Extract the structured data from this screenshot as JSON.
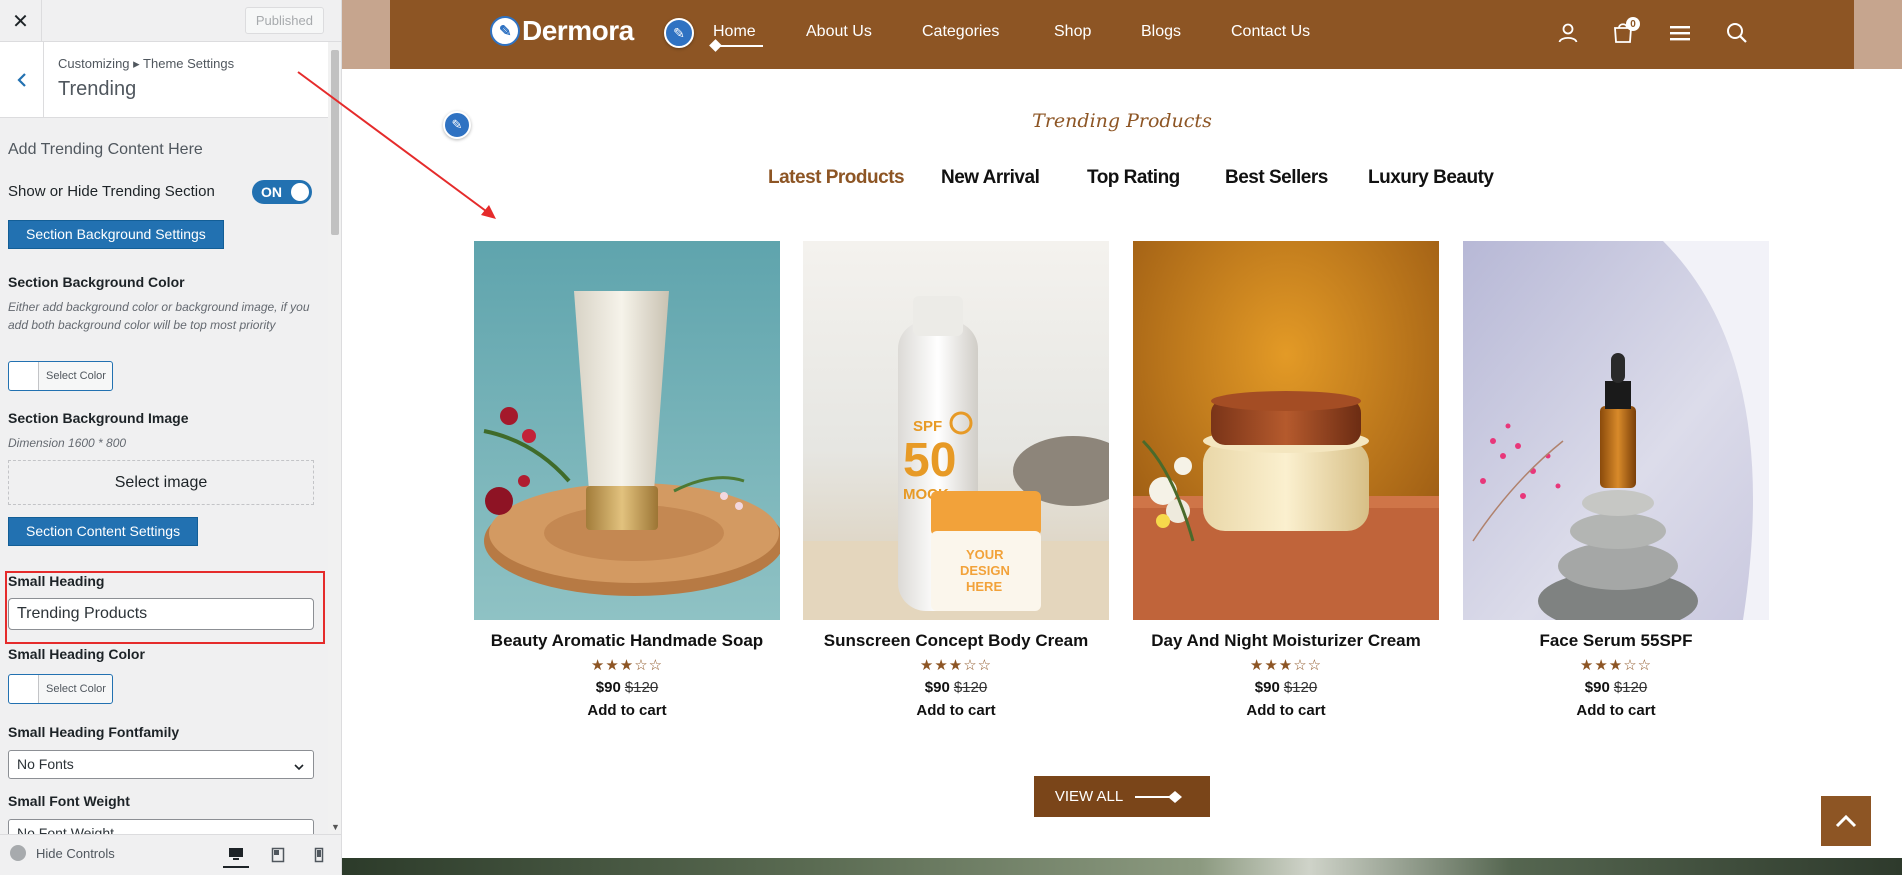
{
  "sidebar": {
    "close_icon": "close-icon",
    "published_label": "Published",
    "breadcrumb": "Customizing ▸ Theme Settings",
    "section_title": "Trending",
    "description": "Add Trending Content Here",
    "show_hide_label": "Show or Hide Trending Section",
    "toggle_label": "ON",
    "bg_settings_button": "Section Background Settings",
    "bg_color_label": "Section Background Color",
    "bg_color_note": "Either add background color or background image, if you add both background color will be top most priority",
    "select_color_label": "Select Color",
    "bg_image_label": "Section Background Image",
    "bg_image_note": "Dimension 1600 * 800",
    "select_image_label": "Select image",
    "content_settings_button": "Section Content Settings",
    "small_heading_label": "Small Heading",
    "small_heading_value": "Trending Products",
    "small_heading_color_label": "Small Heading Color",
    "small_heading_font_label": "Small Heading Fontfamily",
    "small_heading_font_value": "No Fonts",
    "small_font_weight_label": "Small Font Weight",
    "small_font_weight_value": "No Font Weight",
    "hide_controls_label": "Hide Controls"
  },
  "preview": {
    "logo_text": "Dermora",
    "nav_items": [
      "Home",
      "About Us",
      "Categories",
      "Shop",
      "Blogs",
      "Contact Us"
    ],
    "cart_count": "0",
    "small_heading": "Trending Products",
    "tabs": [
      "Latest Products",
      "New Arrival",
      "Top Rating",
      "Best Sellers",
      "Luxury Beauty"
    ],
    "products": [
      {
        "name": "Beauty Aromatic Handmade Soap",
        "rating": 3,
        "price": "$90",
        "old_price": "$120",
        "cta": "Add to cart"
      },
      {
        "name": "Sunscreen Concept Body Cream",
        "rating": 3,
        "price": "$90",
        "old_price": "$120",
        "cta": "Add to cart"
      },
      {
        "name": "Day And Night Moisturizer Cream",
        "rating": 3,
        "price": "$90",
        "old_price": "$120",
        "cta": "Add to cart"
      },
      {
        "name": "Face Serum 55SPF",
        "rating": 3,
        "price": "$90",
        "old_price": "$120",
        "cta": "Add to cart"
      }
    ],
    "product_image_text": {
      "spf": "SPF",
      "fifty": "50",
      "mock": "MOCK",
      "your": "YOUR",
      "design": "DESIGN",
      "here": "HERE"
    },
    "view_all_label": "VIEW ALL"
  },
  "colors": {
    "brand_brown": "#8d5524",
    "wp_blue": "#2271b1",
    "highlight_red": "#e52b2b"
  }
}
